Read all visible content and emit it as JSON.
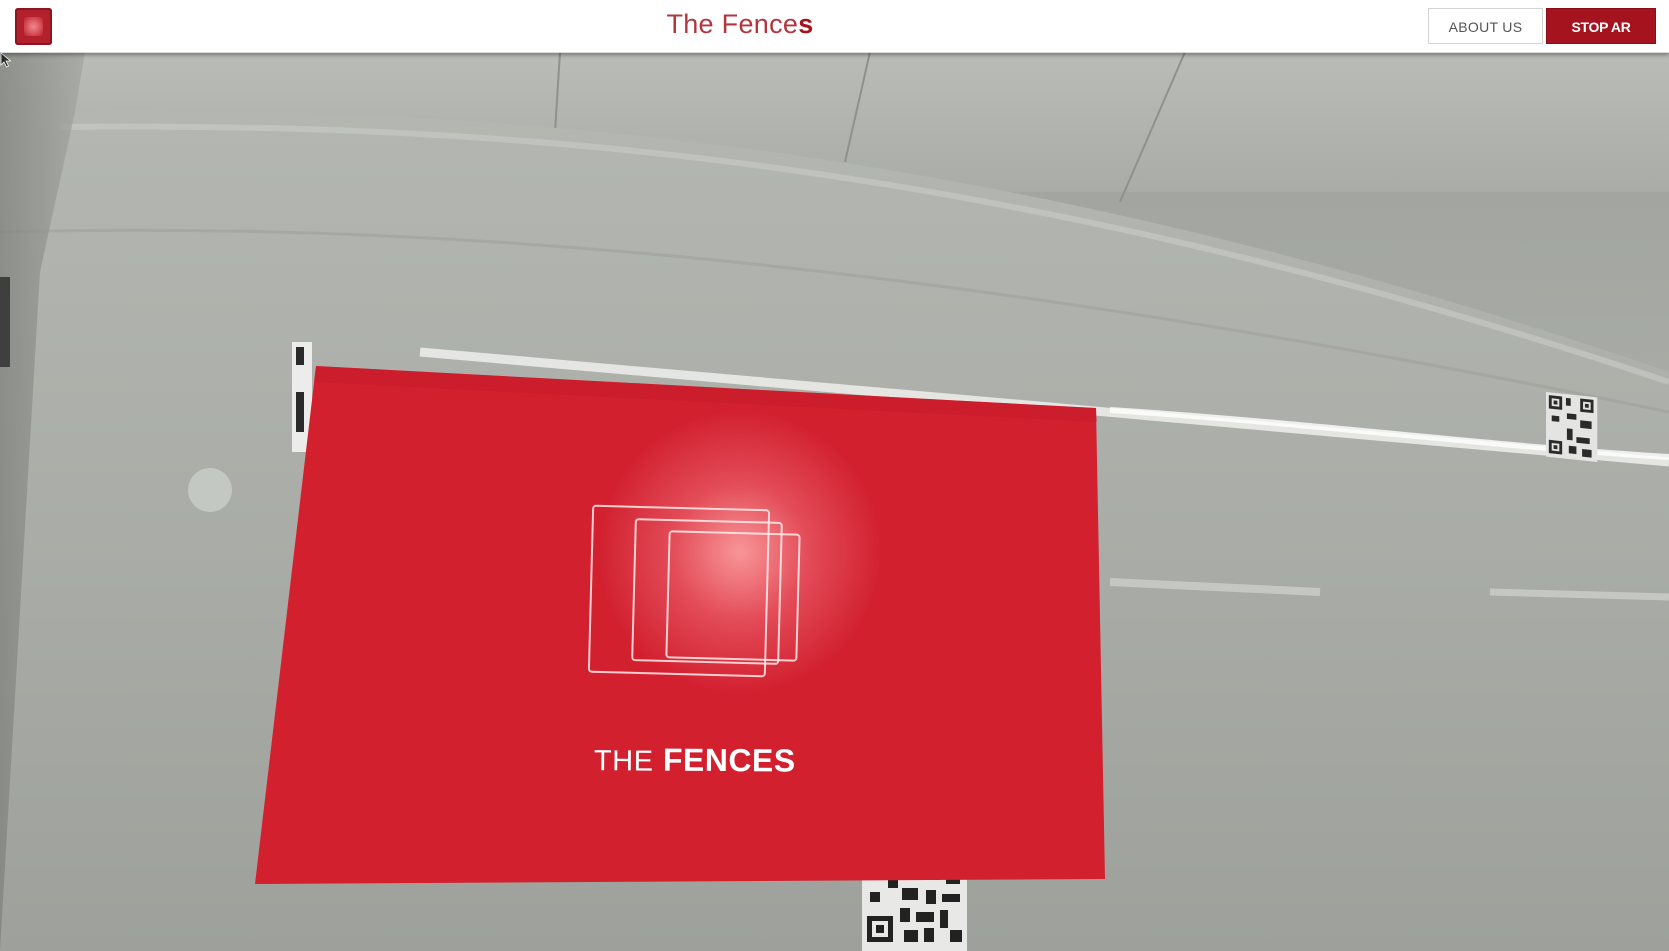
{
  "header": {
    "title_main": "The Fence",
    "title_accent": "s",
    "about_label": "ABOUT US",
    "stop_label": "STOP AR"
  },
  "ar_card": {
    "heading_light": "THE",
    "heading_bold": "FENCES",
    "color": "#d2202f"
  },
  "colors": {
    "brand_red": "#a5131f",
    "title_red": "#b3363f",
    "header_bg": "#ffffff"
  },
  "icons": {
    "logo": "app-logo-icon",
    "fences": "fences-logo-icon",
    "cursor": "mouse-cursor-icon",
    "qr": "qr-code-icon"
  }
}
